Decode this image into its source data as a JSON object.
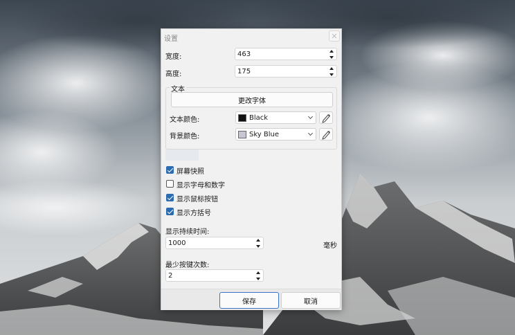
{
  "dialog": {
    "title": "设置",
    "width_label": "宽度:",
    "width_value": "463",
    "height_label": "高度:",
    "height_value": "175",
    "text_group_label": "文本",
    "change_font_label": "更改字体",
    "text_color_label": "文本颜色:",
    "text_color_value": "Black",
    "text_color_hex": "#111111",
    "bg_color_label": "背景颜色:",
    "bg_color_value": "Sky Blue",
    "bg_color_hex": "#c7c7d4",
    "checkboxes": [
      {
        "label": "屏幕快照",
        "checked": true
      },
      {
        "label": "显示字母和数字",
        "checked": false
      },
      {
        "label": "显示鼠标按钮",
        "checked": true
      },
      {
        "label": "显示方括号",
        "checked": true
      }
    ],
    "duration_label": "显示持续时间:",
    "duration_value": "1000",
    "duration_unit": "毫秒",
    "min_keys_label": "最少按键次数:",
    "min_keys_value": "2",
    "save_label": "保存",
    "cancel_label": "取消"
  },
  "colors": {
    "accent": "#2b6cb0",
    "dialog_bg": "#f1f1f1"
  }
}
